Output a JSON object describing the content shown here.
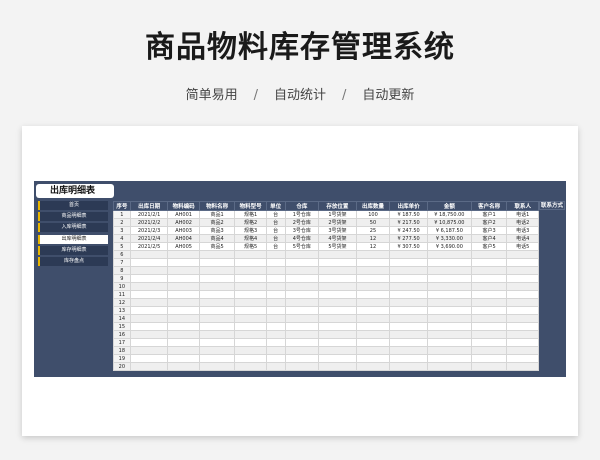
{
  "header": {
    "title": "商品物料库存管理系统",
    "features": [
      "简单易用",
      "自动统计",
      "自动更新"
    ],
    "separator": "/"
  },
  "sheet": {
    "title": "出库明细表"
  },
  "nav": {
    "items": [
      {
        "label": "首页",
        "active": false
      },
      {
        "label": "商品明细表",
        "active": false
      },
      {
        "label": "入库明细表",
        "active": false
      },
      {
        "label": "出库明细表",
        "active": true
      },
      {
        "label": "库存明细表",
        "active": false
      },
      {
        "label": "库存盘点",
        "active": false
      }
    ]
  },
  "table": {
    "columns": [
      "序号",
      "出库日期",
      "物料编码",
      "物料名称",
      "物料型号",
      "单位",
      "仓库",
      "存放位置",
      "出库数量",
      "出库单价",
      "金额",
      "客户名称",
      "联系人"
    ],
    "extra_column": "联系方式",
    "rows": [
      [
        "1",
        "2021/2/1",
        "AH001",
        "商品1",
        "规格1",
        "台",
        "1号仓库",
        "1号货架",
        "100",
        "¥ 187.50",
        "¥ 18,750.00",
        "客户1",
        "电话1"
      ],
      [
        "2",
        "2021/2/2",
        "AH002",
        "商品2",
        "规格2",
        "台",
        "2号仓库",
        "2号货架",
        "50",
        "¥ 217.50",
        "¥ 10,875.00",
        "客户2",
        "电话2"
      ],
      [
        "3",
        "2021/2/3",
        "AH003",
        "商品3",
        "规格3",
        "台",
        "3号仓库",
        "3号货架",
        "25",
        "¥ 247.50",
        "¥ 6,187.50",
        "客户3",
        "电话3"
      ],
      [
        "4",
        "2021/2/4",
        "AH004",
        "商品4",
        "规格4",
        "台",
        "4号仓库",
        "4号货架",
        "12",
        "¥ 277.50",
        "¥ 3,330.00",
        "客户4",
        "电话4"
      ],
      [
        "5",
        "2021/2/5",
        "AH005",
        "商品5",
        "规格5",
        "台",
        "5号仓库",
        "5号货架",
        "12",
        "¥ 307.50",
        "¥ 3,690.00",
        "客户5",
        "电话5"
      ],
      [
        "6"
      ],
      [
        "7"
      ],
      [
        "8"
      ],
      [
        "9"
      ],
      [
        "10"
      ],
      [
        "11"
      ],
      [
        "12"
      ],
      [
        "13"
      ],
      [
        "14"
      ],
      [
        "15"
      ],
      [
        "16"
      ],
      [
        "17"
      ],
      [
        "18"
      ],
      [
        "19"
      ],
      [
        "20"
      ]
    ]
  },
  "colors": {
    "panel": "#3f4e6b",
    "nav_accent": "#e8b600"
  }
}
